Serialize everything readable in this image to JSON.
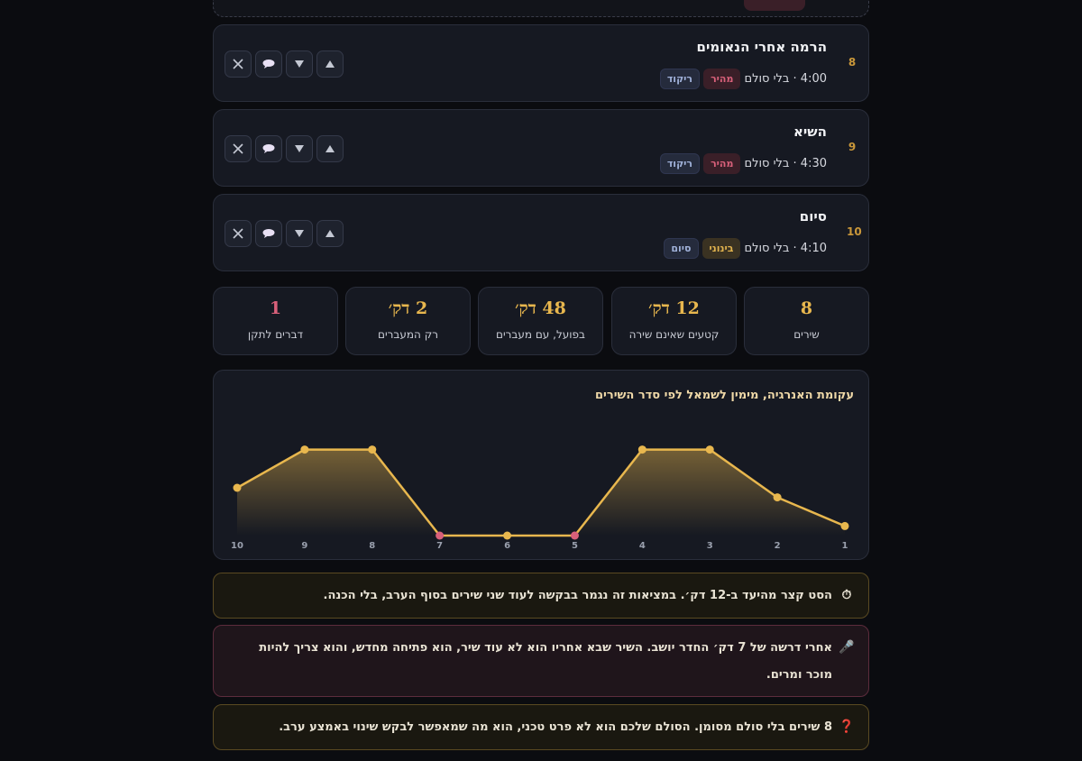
{
  "songs": [
    {
      "num": "8",
      "title": "הרמה אחרי הנאומים",
      "meta": "4:00 · בלי סולם",
      "tempo": "מהיר",
      "tempo_kind": "fast",
      "role": "ריקוד"
    },
    {
      "num": "9",
      "title": "השיא",
      "meta": "4:30 · בלי סולם",
      "tempo": "מהיר",
      "tempo_kind": "fast",
      "role": "ריקוד"
    },
    {
      "num": "10",
      "title": "סיום",
      "meta": "4:10 · בלי סולם",
      "tempo": "בינוני",
      "tempo_kind": "mid",
      "role": "סיום"
    }
  ],
  "controls": {
    "up": "up-arrow",
    "down": "down-arrow",
    "comment": "speech-bubble",
    "remove": "close-x"
  },
  "stats": [
    {
      "value": "8",
      "label": "שירים",
      "tone": "normal"
    },
    {
      "value": "12 דק׳",
      "label": "קטעים שאינם שירה",
      "tone": "normal"
    },
    {
      "value": "48 דק׳",
      "label": "בפועל, עם מעברים",
      "tone": "normal"
    },
    {
      "value": "2 דק׳",
      "label": "רק המעברים",
      "tone": "normal"
    },
    {
      "value": "1",
      "label": "דברים לתקן",
      "tone": "warn"
    }
  ],
  "chart_data": {
    "type": "area",
    "title": "עקומת האנרגיה, מימין לשמאל לפי סדר השירים",
    "x": [
      "1",
      "2",
      "3",
      "4",
      "5",
      "6",
      "7",
      "8",
      "9",
      "10"
    ],
    "values": [
      0.1,
      0.4,
      0.9,
      0.9,
      0.0,
      0.0,
      0.0,
      0.9,
      0.9,
      0.5
    ],
    "flagged": [
      "5",
      "7"
    ],
    "x_direction": "right-to-left",
    "ylim": [
      0,
      1
    ],
    "grid": false,
    "colors": {
      "line": "#e8b74e",
      "point": "#e8b74e",
      "flagged_point": "#d8607a"
    }
  },
  "notes": [
    {
      "icon": "⏱",
      "icon_name": "stopwatch-icon",
      "text": "הסט קצר מהיעד ב-12 דק׳. במציאות זה נגמר בבקשה לעוד שני שירים בסוף הערב, בלי הכנה.",
      "tone": "amber"
    },
    {
      "icon": "🎤",
      "icon_name": "microphone-icon",
      "text": "אחרי דרשה של 7 דק׳ החדר יושב. השיר שבא אחריו הוא לא עוד שיר, הוא פתיחה מחדש, והוא צריך להיות מוכר ומרים.",
      "tone": "rose"
    },
    {
      "icon": "❓",
      "icon_name": "question-icon",
      "text": "8 שירים בלי סולם מסומן. הסולם שלכם הוא לא פרט טכני, הוא מה שמאפשר לבקש שינוי באמצע ערב.",
      "tone": "amber"
    }
  ],
  "colors": {
    "accent": "#e8b74e",
    "warn": "#d8607a",
    "card": "#161922",
    "background": "#0b0c10"
  }
}
